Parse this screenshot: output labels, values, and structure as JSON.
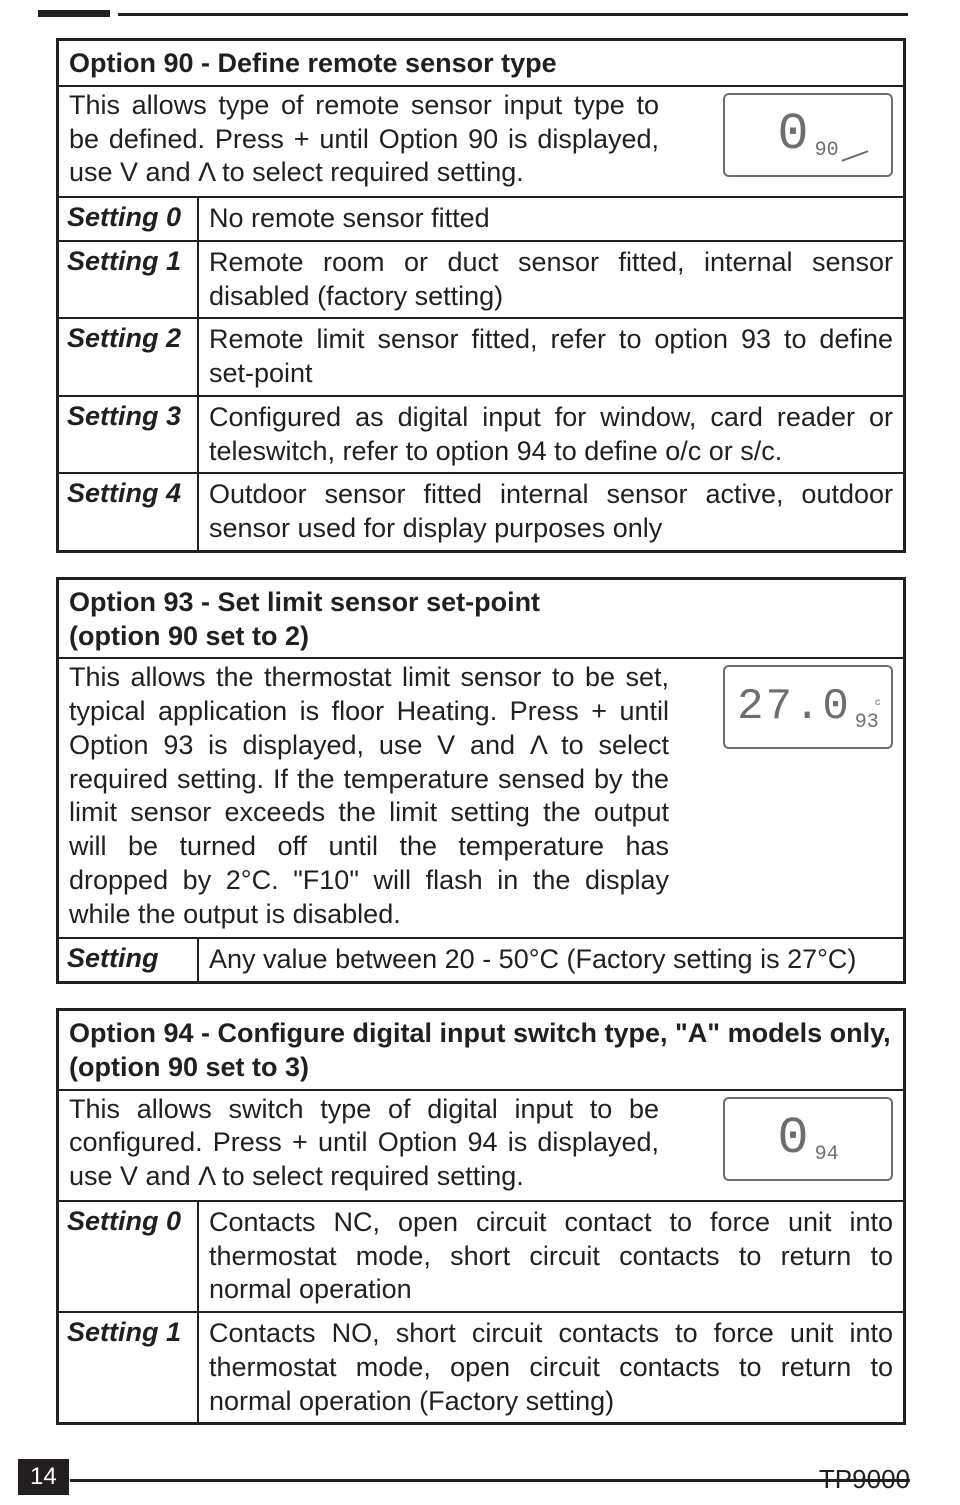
{
  "option90": {
    "title": "Option 90 - Define remote sensor type",
    "intro": "This allows type of remote sensor input type to be defined. Press + until Option 90 is displayed, use V and Λ to select required setting.",
    "lcd_big": "0",
    "lcd_small": "90",
    "rows": [
      {
        "label": "Setting 0",
        "value": "No remote sensor fitted"
      },
      {
        "label": "Setting 1",
        "value": "Remote room or duct sensor fitted, internal sensor disabled (factory setting)"
      },
      {
        "label": "Setting 2",
        "value": "Remote limit sensor fitted, refer to option 93 to define set-point"
      },
      {
        "label": "Setting 3",
        "value": "Configured as digital input for window, card reader or teleswitch, refer to option 94 to define o/c or s/c."
      },
      {
        "label": "Setting 4",
        "value": "Outdoor sensor fitted internal sensor active, outdoor sensor used for display purposes only"
      }
    ]
  },
  "option93": {
    "title": "Option 93 - Set limit sensor set-point",
    "subtitle": "(option 90 set to 2)",
    "intro": "This allows the thermostat limit sensor to be set, typical application is floor Heating. Press + until Option 93 is displayed, use V and Λ to select required setting. If the temperature sensed by the limit sensor exceeds the limit setting the output will be turned off until the temperature has dropped by 2°C. \"F10\" will flash in the display while the output is disabled.",
    "lcd_big": "27.0",
    "lcd_small": "93",
    "lcd_unit": "c",
    "row_label": "Setting",
    "row_value": "Any value between 20 - 50°C (Factory setting is 27°C)"
  },
  "option94": {
    "title": "Option 94 - Configure digital input switch type, \"A\" models only,",
    "subtitle": "(option 90 set to 3)",
    "intro": "This allows switch type of digital input to be configured. Press + until Option 94 is displayed, use V and Λ to select required setting.",
    "lcd_big": "0",
    "lcd_small": "94",
    "rows": [
      {
        "label": "Setting 0",
        "value": "Contacts NC, open circuit contact to force unit into thermostat mode, short circuit contacts to return to normal operation"
      },
      {
        "label": "Setting 1",
        "value": "Contacts NO, short circuit contacts to force unit into thermostat mode, open circuit contacts to return to normal operation (Factory setting)"
      }
    ]
  },
  "footer": {
    "page": "14",
    "model": "TP9000"
  }
}
